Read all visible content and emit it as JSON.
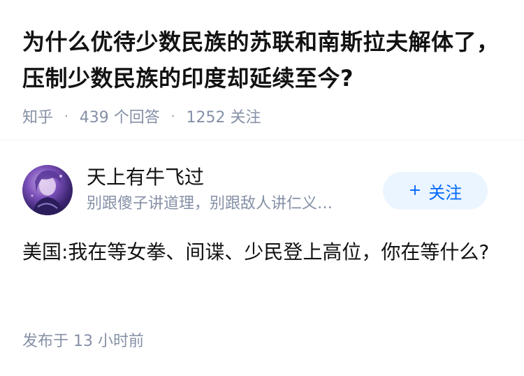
{
  "question": {
    "title": "为什么优待少数民族的苏联和南斯拉夫解体了，压制少数民族的印度却延续至今?",
    "source": "知乎",
    "answers_count": "439 个回答",
    "followers_count": "1252 关注"
  },
  "author": {
    "name": "天上有牛飞过",
    "bio": "别跟傻子讲道理，别跟敌人讲仁义…",
    "follow_label": "关注",
    "follow_icon": "plus-icon",
    "avatar_icon": "avatar-image"
  },
  "answer": {
    "content": "美国:我在等女拳、间谍、少民登上高位，你在等什么?",
    "published": "发布于 13 小时前"
  },
  "colors": {
    "muted": "#8590a6",
    "accent": "#0066ff",
    "follow_bg": "#ebf5ff",
    "text": "#121212"
  }
}
